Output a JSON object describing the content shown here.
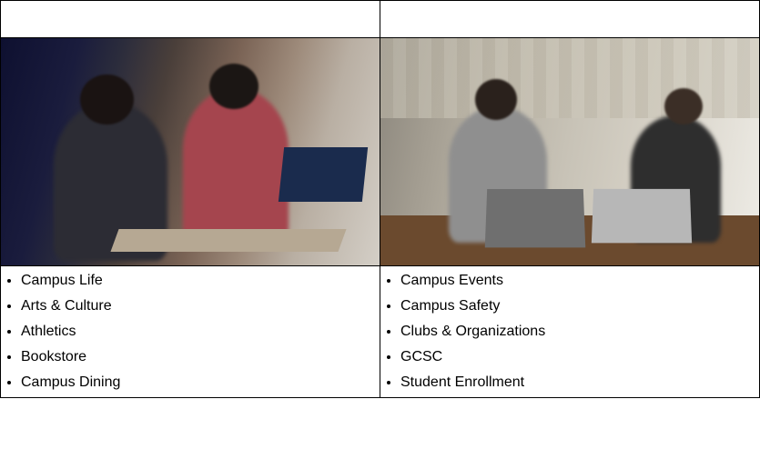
{
  "left": {
    "image_alt": "Two students sitting together at a desk looking at a laptop in a campus lounge",
    "items": [
      "Campus Life",
      "Arts & Culture",
      "Athletics",
      "Bookstore",
      "Campus Dining"
    ]
  },
  "right": {
    "image_alt": "Two students with laptops chatting at a table in a bright campus common area",
    "items": [
      "Campus Events",
      "Campus Safety",
      "Clubs & Organizations",
      "GCSC",
      "Student Enrollment"
    ]
  }
}
